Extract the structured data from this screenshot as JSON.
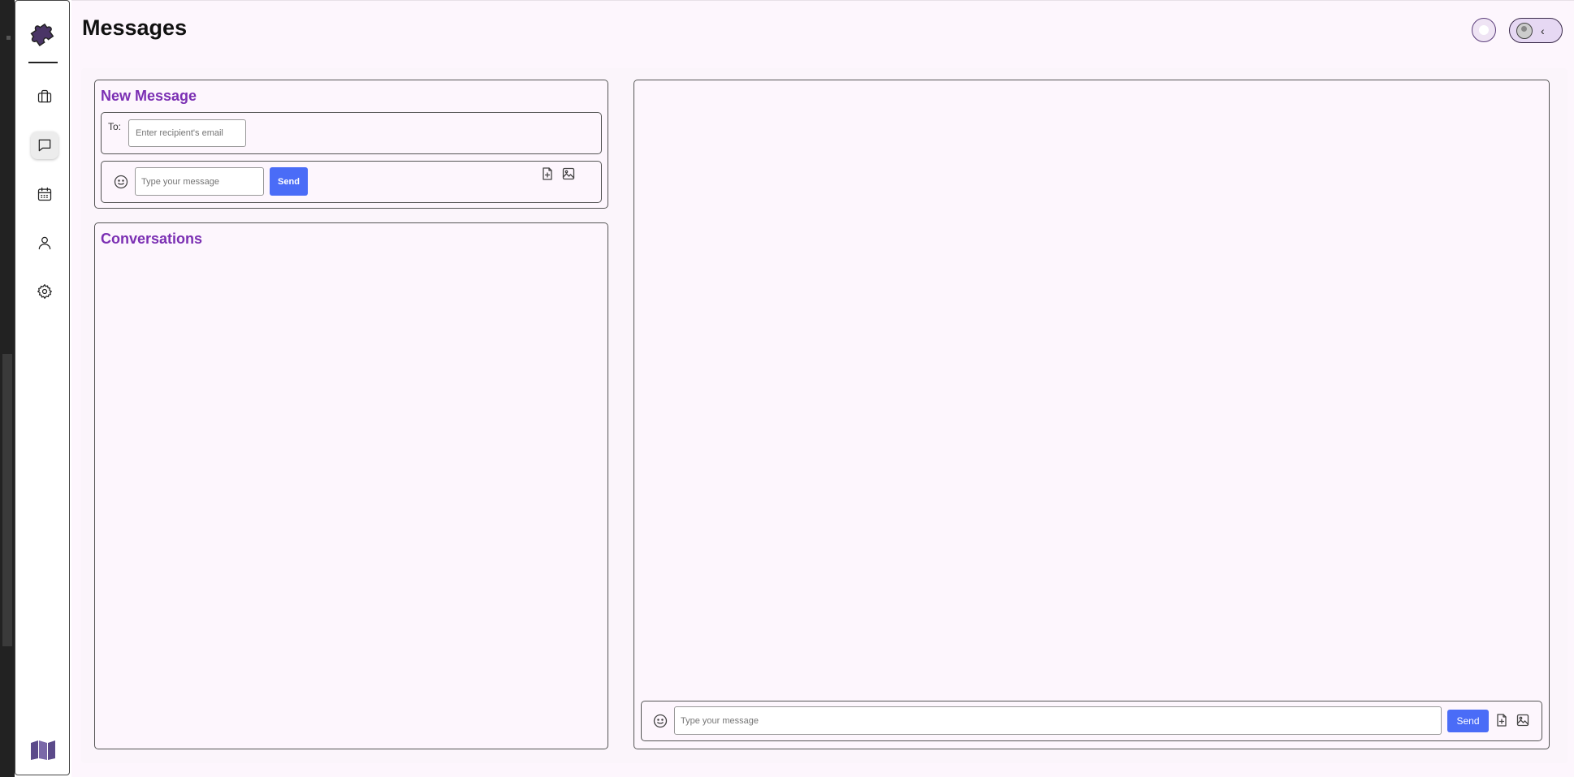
{
  "page": {
    "title": "Messages"
  },
  "sidebar": {
    "items": [
      {
        "name": "briefcase-icon"
      },
      {
        "name": "chat-icon",
        "active": true
      },
      {
        "name": "calendar-icon"
      },
      {
        "name": "user-icon"
      },
      {
        "name": "gear-icon"
      }
    ]
  },
  "new_message": {
    "title": "New Message",
    "to_label": "To:",
    "recipient_placeholder": "Enter recipient's email",
    "message_placeholder": "Type your message",
    "send_label": "Send"
  },
  "conversations": {
    "title": "Conversations",
    "items": []
  },
  "chat_panel": {
    "message_placeholder": "Type your message",
    "send_label": "Send"
  },
  "colors": {
    "accent": "#7b2fb3",
    "send_button": "#4a6cf7",
    "page_bg": "#fdf6fd"
  }
}
